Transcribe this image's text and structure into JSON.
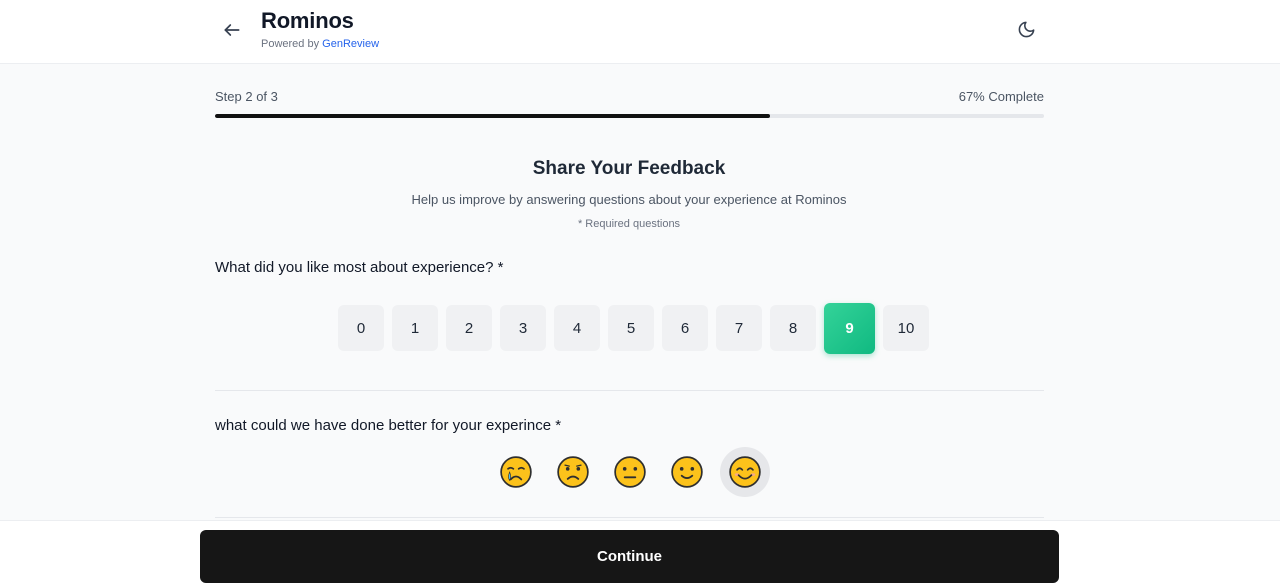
{
  "header": {
    "title": "Rominos",
    "powered_prefix": "Powered by ",
    "powered_link": "GenReview",
    "back_icon": "arrow-left-icon",
    "theme_icon": "moon-icon"
  },
  "progress": {
    "step_label": "Step 2 of 3",
    "complete_label": "67% Complete",
    "fill_percent": 67
  },
  "form": {
    "title": "Share Your Feedback",
    "subtitle": "Help us improve by answering questions about your experience at Rominos",
    "required_note": "* Required questions",
    "question1": "What did you like most about experience? *",
    "scale": [
      "0",
      "1",
      "2",
      "3",
      "4",
      "5",
      "6",
      "7",
      "8",
      "9",
      "10"
    ],
    "scale_selected": "9",
    "question2": "what could we have done better for your experince *",
    "emojis": [
      "crying-face-icon",
      "frowning-face-icon",
      "neutral-face-icon",
      "slightly-smiling-face-icon",
      "smiling-face-icon"
    ],
    "emoji_selected": 4
  },
  "footer": {
    "continue_label": "Continue"
  },
  "colors": {
    "accent": "#10b981",
    "button": "#161616",
    "progress": "#111111"
  }
}
